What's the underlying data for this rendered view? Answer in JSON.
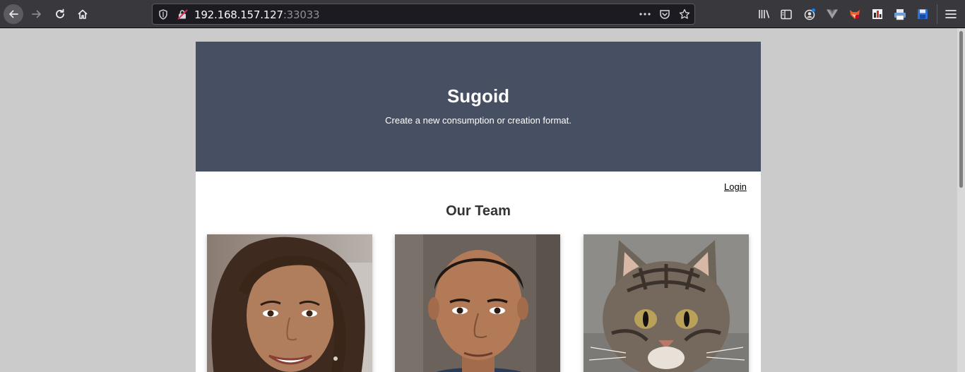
{
  "browser": {
    "url_host": "192.168.157.127",
    "url_port": ":33033",
    "icons": {
      "back": "arrow-left-icon",
      "forward": "arrow-right-icon",
      "reload": "reload-icon",
      "home": "home-icon",
      "tracking": "shield-icon",
      "insecure": "insecure-lock-icon",
      "page_actions": "ellipsis-icon",
      "pocket": "pocket-icon",
      "bookmark": "star-icon",
      "library": "library-icon",
      "sidebar": "sidebar-icon",
      "account": "account-icon",
      "extensions": [
        "vuejs-devtools-icon",
        "foxyproxy-icon",
        "extension-icon",
        "print-icon",
        "save-icon"
      ],
      "menu": "hamburger-menu-icon"
    }
  },
  "site": {
    "title": "Sugoid",
    "tagline": "Create a new consumption or creation format.",
    "login_label": "Login",
    "team_heading": "Our Team",
    "hero_color": "#475062",
    "team": [
      {
        "photo": "woman-portrait"
      },
      {
        "photo": "man-portrait"
      },
      {
        "photo": "cat-portrait"
      }
    ]
  }
}
